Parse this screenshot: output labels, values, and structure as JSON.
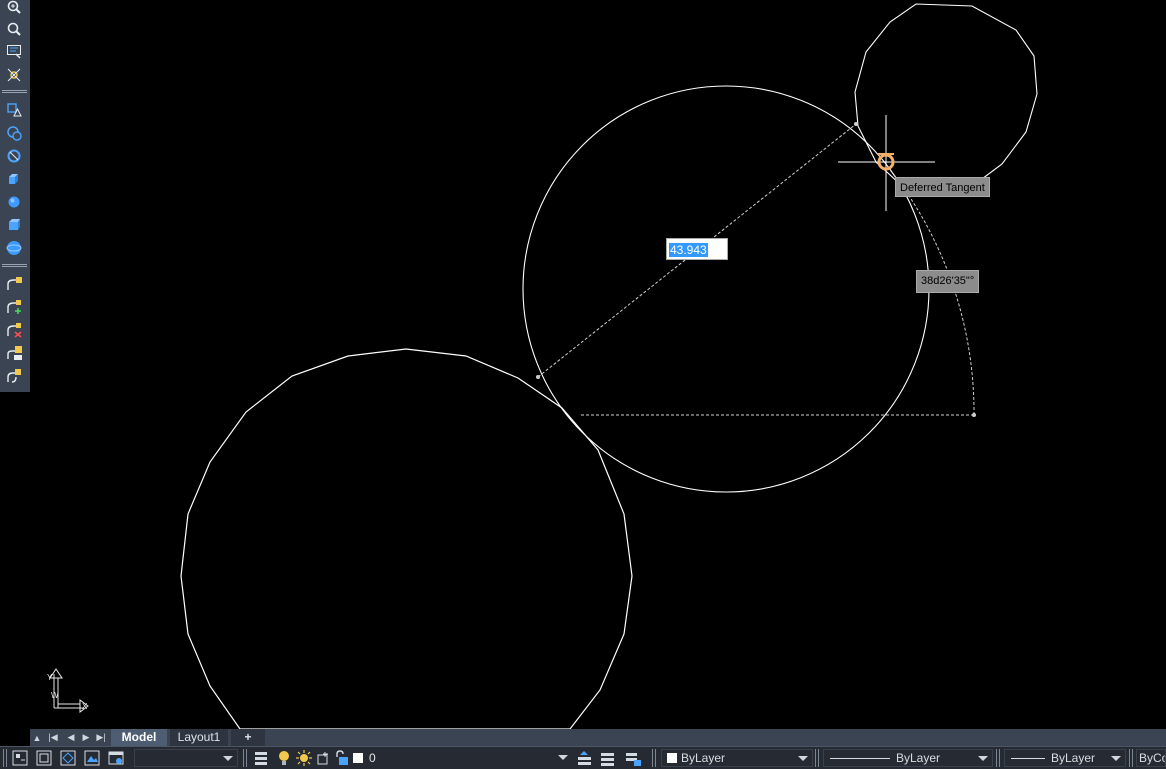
{
  "app": {
    "tooltips": {
      "snap": "Deferred Tangent",
      "angle": "38d26'35\"°"
    },
    "dynamic_input": {
      "value": "43.943"
    }
  },
  "left_toolbar": {
    "buttons": [
      {
        "name": "zoom-realtime-icon"
      },
      {
        "name": "zoom-window-icon"
      },
      {
        "name": "zoom-extents-icon"
      },
      {
        "name": "pan-orbit-icon"
      },
      {
        "name": "visual-style-wireframe-icon"
      },
      {
        "name": "visual-style-hidden-icon"
      },
      {
        "name": "visual-style-realistic-icon"
      },
      {
        "name": "box-solid-icon"
      },
      {
        "name": "sphere-icon"
      },
      {
        "name": "cylinder-icon"
      },
      {
        "name": "globe-icon"
      },
      {
        "name": "polyline-edit-icon"
      },
      {
        "name": "polyline-add-vertex-icon"
      },
      {
        "name": "polyline-remove-vertex-icon"
      },
      {
        "name": "polyline-join-icon"
      },
      {
        "name": "polyline-convert-icon"
      }
    ]
  },
  "tabs": {
    "items": [
      {
        "label": "Model",
        "active": true
      },
      {
        "label": "Layout1",
        "active": false
      }
    ],
    "add_label": "+"
  },
  "statusbar": {
    "layer_value": "0",
    "color_value": "ByLayer",
    "linetype_value": "ByLayer",
    "lineweight_value": "ByLayer",
    "plotstyle_value": "ByCol"
  },
  "ucs": {
    "x_label": "X",
    "y_label": "Y",
    "w_label": "W"
  },
  "colors": {
    "canvas_bg": "#000000",
    "geometry": "#ffffff",
    "snap_marker": "#f5b169",
    "selection_blue": "#3399ff",
    "toolbar_bg": "#3b4453"
  }
}
